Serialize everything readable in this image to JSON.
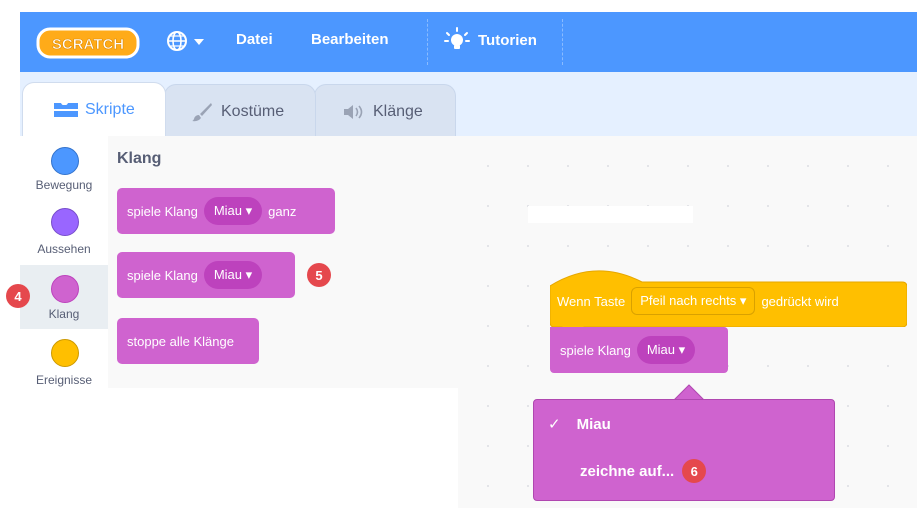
{
  "menu": {
    "logo_text": "SCRATCH",
    "language_icon": "globe-icon",
    "file": "Datei",
    "edit": "Bearbeiten",
    "tutorials": "Tutorien",
    "tutorials_icon": "lightbulb-icon"
  },
  "tabs": [
    {
      "label": "Skripte",
      "icon": "code-icon",
      "active": true
    },
    {
      "label": "Kostüme",
      "icon": "brush-icon",
      "active": false
    },
    {
      "label": "Klänge",
      "icon": "speaker-icon",
      "active": false
    }
  ],
  "categories": [
    {
      "label": "Bewegung",
      "color": "#4c97ff"
    },
    {
      "label": "Aussehen",
      "color": "#9966ff"
    },
    {
      "label": "Klang",
      "color": "#cf63cf",
      "selected": true
    },
    {
      "label": "Ereignisse",
      "color": "#ffbf00"
    }
  ],
  "palette": {
    "title": "Klang",
    "block1": {
      "prefix": "spiele Klang",
      "value": "Miau",
      "suffix": "ganz"
    },
    "block2": {
      "prefix": "spiele Klang",
      "value": "Miau"
    },
    "block3": {
      "text": "stoppe alle Klänge"
    }
  },
  "badges": {
    "b4": "4",
    "b5": "5",
    "b6": "6"
  },
  "script": {
    "hat_prefix": "Wenn Taste",
    "hat_value": "Pfeil nach rechts",
    "hat_suffix": "gedrückt wird",
    "play_prefix": "spiele Klang",
    "play_value": "Miau"
  },
  "dropdown": {
    "check": "✓",
    "item1": "Miau",
    "item2": "zeichne auf..."
  },
  "colors": {
    "menu_bg": "#4c97ff",
    "sound": "#cf63cf",
    "events": "#ffbf00",
    "badge": "#e5484d"
  }
}
